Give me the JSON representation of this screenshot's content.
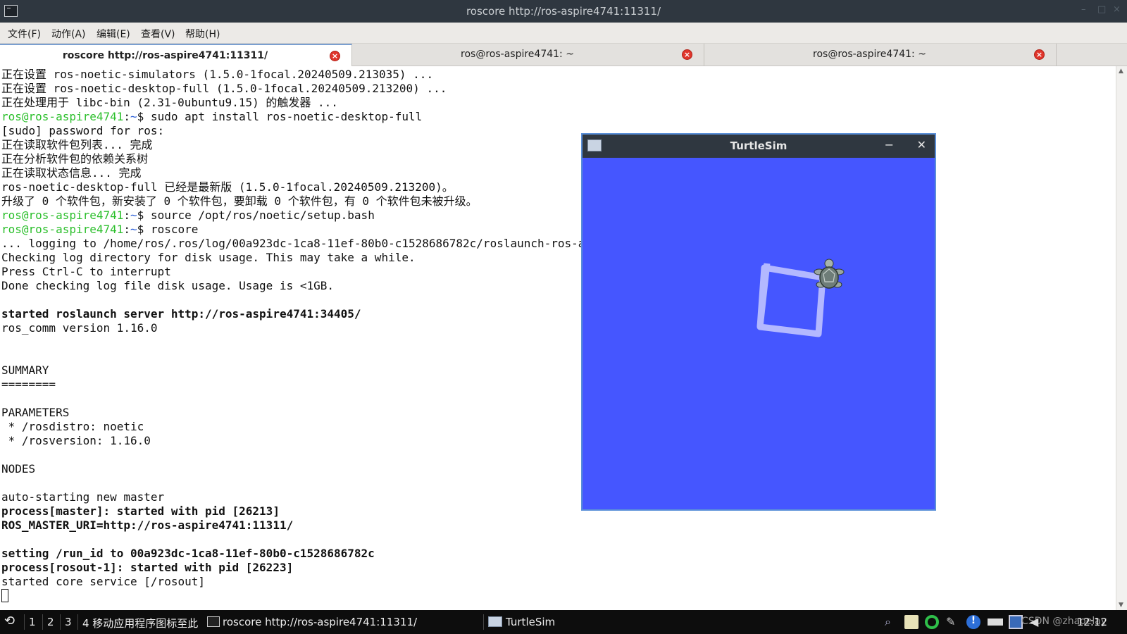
{
  "window": {
    "title": "roscore http://ros-aspire4741:11311/"
  },
  "menu": [
    "文件(F)",
    "动作(A)",
    "编辑(E)",
    "查看(V)",
    "帮助(H)"
  ],
  "tabs": [
    {
      "label": "roscore http://ros-aspire4741:11311/",
      "active": true
    },
    {
      "label": "ros@ros-aspire4741: ~",
      "active": false
    },
    {
      "label": "ros@ros-aspire4741: ~",
      "active": false
    }
  ],
  "terminal": {
    "prompt_user": "ros@ros-aspire4741",
    "prompt_path": "~",
    "lines": [
      {
        "text": "正在设置 ros-noetic-simulators (1.5.0-1focal.20240509.213035) ..."
      },
      {
        "text": "正在设置 ros-noetic-desktop-full (1.5.0-1focal.20240509.213200) ..."
      },
      {
        "text": "正在处理用于 libc-bin (2.31-0ubuntu9.15) 的触发器 ..."
      },
      {
        "prompt": true,
        "text": "sudo apt install ros-noetic-desktop-full"
      },
      {
        "text": "[sudo] password for ros:"
      },
      {
        "text": "正在读取软件包列表... 完成"
      },
      {
        "text": "正在分析软件包的依赖关系树"
      },
      {
        "text": "正在读取状态信息... 完成"
      },
      {
        "text": "ros-noetic-desktop-full 已经是最新版 (1.5.0-1focal.20240509.213200)。"
      },
      {
        "text": "升级了 0 个软件包，新安装了 0 个软件包，要卸载 0 个软件包，有 0 个软件包未被升级。"
      },
      {
        "prompt": true,
        "text": "source /opt/ros/noetic/setup.bash"
      },
      {
        "prompt": true,
        "text": "roscore"
      },
      {
        "text": "... logging to /home/ros/.ros/log/00a923dc-1ca8-11ef-80b0-c1528686782c/roslaunch-ros-aspire4741-26199.log"
      },
      {
        "text": "Checking log directory for disk usage. This may take a while."
      },
      {
        "text": "Press Ctrl-C to interrupt"
      },
      {
        "text": "Done checking log file disk usage. Usage is <1GB."
      },
      {
        "text": ""
      },
      {
        "text": "started roslaunch server http://ros-aspire4741:34405/",
        "bold": true
      },
      {
        "text": "ros_comm version 1.16.0"
      },
      {
        "text": ""
      },
      {
        "text": ""
      },
      {
        "text": "SUMMARY"
      },
      {
        "text": "========"
      },
      {
        "text": ""
      },
      {
        "text": "PARAMETERS"
      },
      {
        "text": " * /rosdistro: noetic"
      },
      {
        "text": " * /rosversion: 1.16.0"
      },
      {
        "text": ""
      },
      {
        "text": "NODES"
      },
      {
        "text": ""
      },
      {
        "text": "auto-starting new master"
      },
      {
        "text": "process[master]: started with pid [26213]",
        "bold": true
      },
      {
        "text": "ROS_MASTER_URI=http://ros-aspire4741:11311/",
        "bold": true
      },
      {
        "text": ""
      },
      {
        "text": "setting /run_id to 00a923dc-1ca8-11ef-80b0-c1528686782c",
        "bold": true
      },
      {
        "text": "process[rosout-1]: started with pid [26223]",
        "bold": true
      },
      {
        "text": "started core service [/rosout]"
      }
    ]
  },
  "turtlesim": {
    "title": "TurtleSim",
    "background": "#4556ff",
    "trail_color": "#b3b8ff"
  },
  "taskbar": {
    "workspaces": [
      "1",
      "2",
      "3"
    ],
    "hint": "4 移动应用程序图标至此",
    "tasks": [
      {
        "label": "roscore http://ros-aspire4741:11311/"
      },
      {
        "label": "TurtleSim"
      }
    ],
    "watermark": "CSDN @zhaoelay",
    "clock": "12:12"
  },
  "colors": {
    "prompt_user": "#2bbf2b",
    "prompt_path": "#2b5fd8",
    "tab_close": "#e0352b"
  }
}
